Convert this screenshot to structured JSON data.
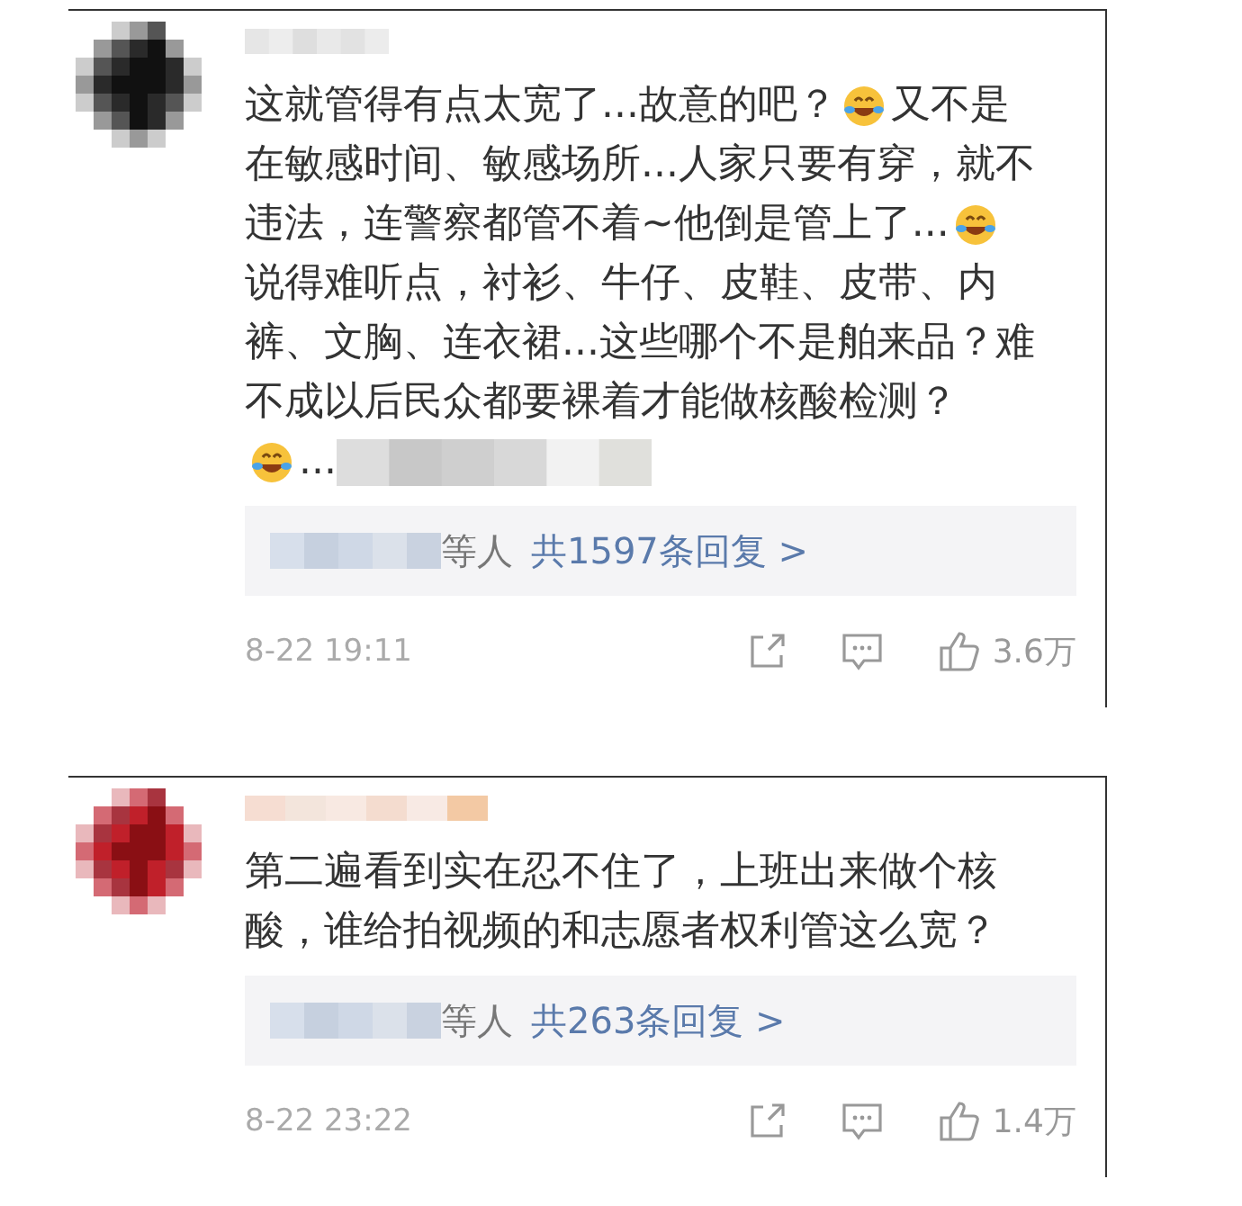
{
  "comments": [
    {
      "avatar": {
        "kind": "picture"
      },
      "lines": [
        [
          {
            "kind": "text",
            "text": "这就管得有点太宽了...故意的吧？"
          },
          {
            "kind": "emoji"
          },
          {
            "kind": "text",
            "text": "又不是"
          }
        ],
        [
          {
            "kind": "text",
            "text": "在敏感时间、敏感场所...人家只要有穿，就不"
          }
        ],
        [
          {
            "kind": "text",
            "text": "违法，连警察都管不着~他倒是管上了..."
          },
          {
            "kind": "emoji"
          }
        ],
        [
          {
            "kind": "text",
            "text": "说得难听点，衬衫、牛仔、皮鞋、皮带、内"
          }
        ],
        [
          {
            "kind": "text",
            "text": "裤、文胸、连衣裙...这些哪个不是舶来品？难"
          }
        ],
        [
          {
            "kind": "text",
            "text": "不成以后民众都要裸着才能做核酸检测？"
          }
        ],
        [
          {
            "kind": "emoji"
          },
          {
            "kind": "text",
            "text": "..."
          },
          {
            "kind": "blur"
          }
        ]
      ],
      "replies": {
        "suffix": "等人",
        "link": "共1597条回复 >"
      },
      "time": "8-22 19:11",
      "likes": "3.6万"
    },
    {
      "avatar": {
        "kind": "picture"
      },
      "lines": [
        [
          {
            "kind": "text",
            "text": "第二遍看到实在忍不住了，上班出来做个核"
          }
        ],
        [
          {
            "kind": "text",
            "text": "酸，谁给拍视频的和志愿者权利管这么宽？"
          }
        ]
      ],
      "replies": {
        "suffix": "等人",
        "link": "共263条回复 >"
      },
      "time": "8-22 23:22",
      "likes": "1.4万"
    }
  ]
}
